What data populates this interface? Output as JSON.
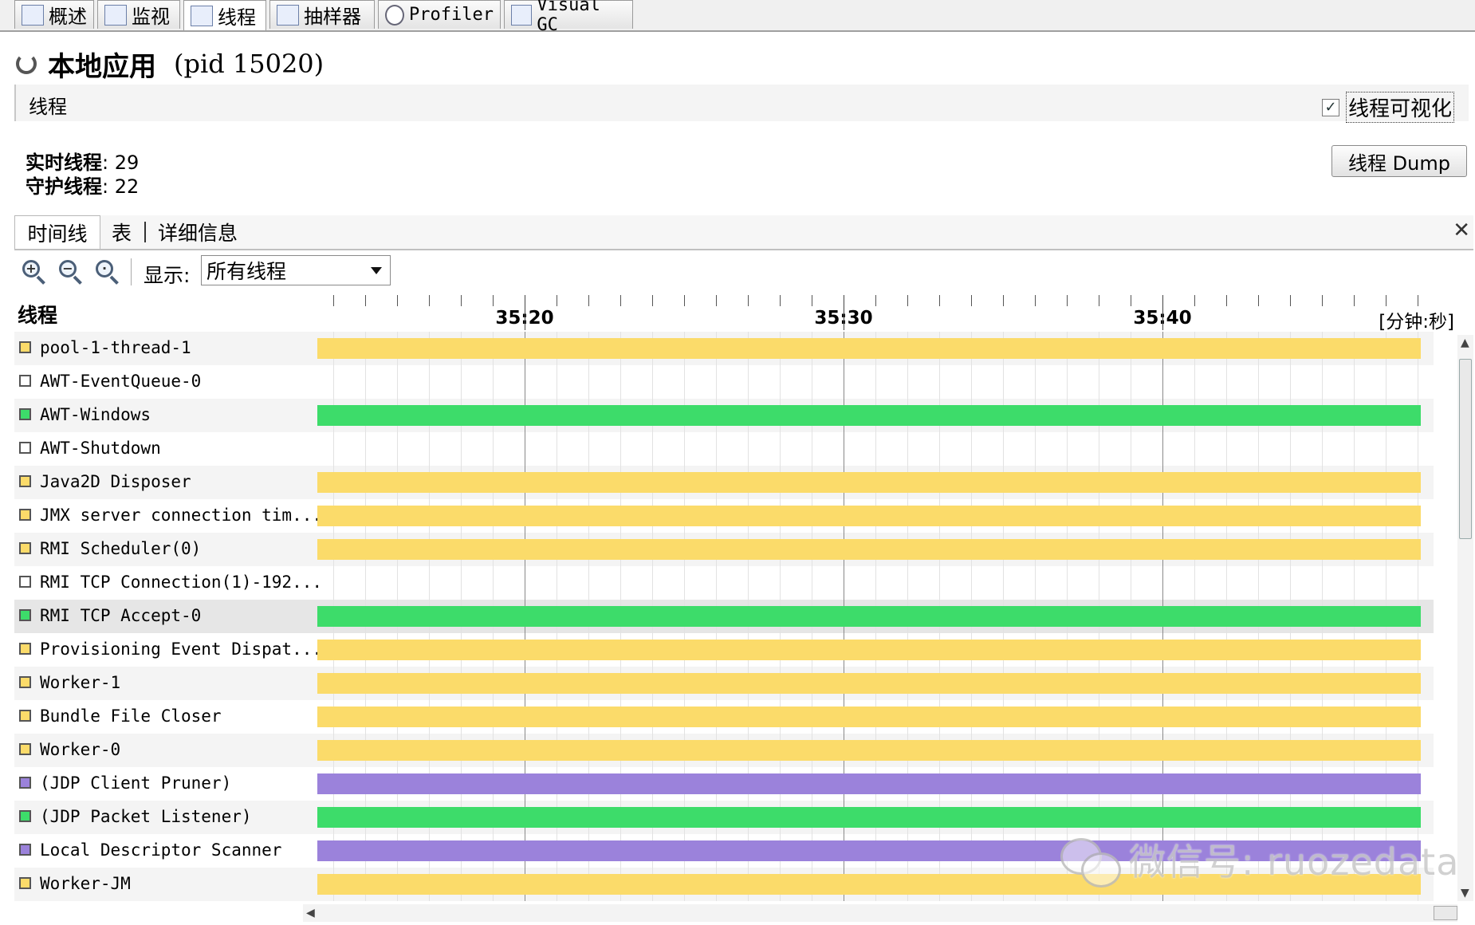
{
  "tabs": [
    {
      "label": "概述",
      "icon": "overview-icon"
    },
    {
      "label": "监视",
      "icon": "monitor-chart-icon"
    },
    {
      "label": "线程",
      "icon": "threads-list-icon"
    },
    {
      "label": "抽样器",
      "icon": "sampler-icon"
    },
    {
      "label": "Profiler",
      "icon": "profiler-clock-icon"
    },
    {
      "label": "Visual GC",
      "icon": "visual-gc-icon"
    }
  ],
  "active_tab": "线程",
  "app": {
    "title": "本地应用",
    "pid": "(pid 15020)"
  },
  "section": {
    "title": "线程",
    "visualize_label": "线程可视化",
    "visualize_checked": true
  },
  "stats": {
    "live_label": "实时线程",
    "live_value": "29",
    "daemon_label": "守护线程",
    "daemon_value": "22",
    "separator": ": "
  },
  "dump_button": "线程 Dump",
  "subtabs": [
    "时间线",
    "表",
    "详细信息"
  ],
  "toolbar": {
    "show_label": "显示:",
    "show_value": "所有线程"
  },
  "timeline": {
    "thread_column": "线程",
    "time_labels": [
      "35:20",
      "35:30",
      "35:40"
    ],
    "unit_label": "[分钟:秒]"
  },
  "state_colors": {
    "running": "#3ddc6a",
    "waiting": "#fbdb6a",
    "monitor": "#9b82db",
    "none": "#ffffff"
  },
  "threads": [
    {
      "name": "pool-1-thread-1",
      "state": "waiting"
    },
    {
      "name": "AWT-EventQueue-0",
      "state": "none"
    },
    {
      "name": "AWT-Windows",
      "state": "running"
    },
    {
      "name": "AWT-Shutdown",
      "state": "none"
    },
    {
      "name": "Java2D Disposer",
      "state": "waiting"
    },
    {
      "name": "JMX server connection tim...",
      "state": "waiting"
    },
    {
      "name": "RMI Scheduler(0)",
      "state": "waiting"
    },
    {
      "name": "RMI TCP Connection(1)-192...",
      "state": "none"
    },
    {
      "name": "RMI TCP Accept-0",
      "state": "running"
    },
    {
      "name": "Provisioning Event Dispat...",
      "state": "waiting"
    },
    {
      "name": "Worker-1",
      "state": "waiting"
    },
    {
      "name": "Bundle File Closer",
      "state": "waiting"
    },
    {
      "name": "Worker-0",
      "state": "waiting"
    },
    {
      "name": "(JDP Client Pruner)",
      "state": "monitor"
    },
    {
      "name": "(JDP Packet Listener)",
      "state": "running"
    },
    {
      "name": "Local Descriptor Scanner",
      "state": "monitor"
    },
    {
      "name": "Worker-JM",
      "state": "waiting"
    }
  ],
  "selected_thread": "RMI TCP Accept-0",
  "watermark": "微信号: ruozedata"
}
